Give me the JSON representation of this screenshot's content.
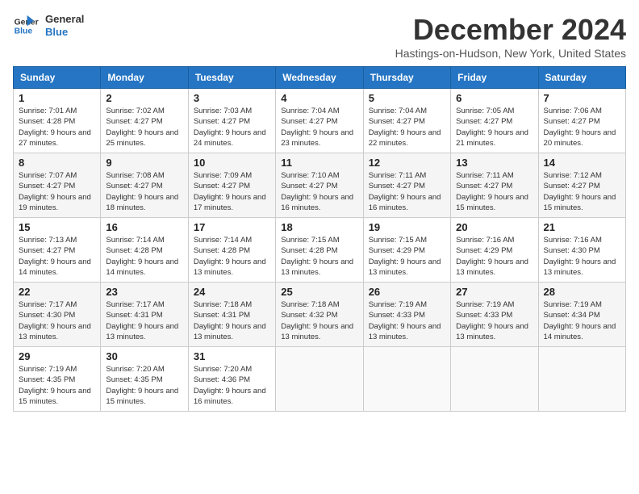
{
  "logo": {
    "line1": "General",
    "line2": "Blue"
  },
  "title": "December 2024",
  "location": "Hastings-on-Hudson, New York, United States",
  "headers": [
    "Sunday",
    "Monday",
    "Tuesday",
    "Wednesday",
    "Thursday",
    "Friday",
    "Saturday"
  ],
  "weeks": [
    [
      {
        "day": "1",
        "sunrise": "Sunrise: 7:01 AM",
        "sunset": "Sunset: 4:28 PM",
        "daylight": "Daylight: 9 hours and 27 minutes."
      },
      {
        "day": "2",
        "sunrise": "Sunrise: 7:02 AM",
        "sunset": "Sunset: 4:27 PM",
        "daylight": "Daylight: 9 hours and 25 minutes."
      },
      {
        "day": "3",
        "sunrise": "Sunrise: 7:03 AM",
        "sunset": "Sunset: 4:27 PM",
        "daylight": "Daylight: 9 hours and 24 minutes."
      },
      {
        "day": "4",
        "sunrise": "Sunrise: 7:04 AM",
        "sunset": "Sunset: 4:27 PM",
        "daylight": "Daylight: 9 hours and 23 minutes."
      },
      {
        "day": "5",
        "sunrise": "Sunrise: 7:04 AM",
        "sunset": "Sunset: 4:27 PM",
        "daylight": "Daylight: 9 hours and 22 minutes."
      },
      {
        "day": "6",
        "sunrise": "Sunrise: 7:05 AM",
        "sunset": "Sunset: 4:27 PM",
        "daylight": "Daylight: 9 hours and 21 minutes."
      },
      {
        "day": "7",
        "sunrise": "Sunrise: 7:06 AM",
        "sunset": "Sunset: 4:27 PM",
        "daylight": "Daylight: 9 hours and 20 minutes."
      }
    ],
    [
      {
        "day": "8",
        "sunrise": "Sunrise: 7:07 AM",
        "sunset": "Sunset: 4:27 PM",
        "daylight": "Daylight: 9 hours and 19 minutes."
      },
      {
        "day": "9",
        "sunrise": "Sunrise: 7:08 AM",
        "sunset": "Sunset: 4:27 PM",
        "daylight": "Daylight: 9 hours and 18 minutes."
      },
      {
        "day": "10",
        "sunrise": "Sunrise: 7:09 AM",
        "sunset": "Sunset: 4:27 PM",
        "daylight": "Daylight: 9 hours and 17 minutes."
      },
      {
        "day": "11",
        "sunrise": "Sunrise: 7:10 AM",
        "sunset": "Sunset: 4:27 PM",
        "daylight": "Daylight: 9 hours and 16 minutes."
      },
      {
        "day": "12",
        "sunrise": "Sunrise: 7:11 AM",
        "sunset": "Sunset: 4:27 PM",
        "daylight": "Daylight: 9 hours and 16 minutes."
      },
      {
        "day": "13",
        "sunrise": "Sunrise: 7:11 AM",
        "sunset": "Sunset: 4:27 PM",
        "daylight": "Daylight: 9 hours and 15 minutes."
      },
      {
        "day": "14",
        "sunrise": "Sunrise: 7:12 AM",
        "sunset": "Sunset: 4:27 PM",
        "daylight": "Daylight: 9 hours and 15 minutes."
      }
    ],
    [
      {
        "day": "15",
        "sunrise": "Sunrise: 7:13 AM",
        "sunset": "Sunset: 4:27 PM",
        "daylight": "Daylight: 9 hours and 14 minutes."
      },
      {
        "day": "16",
        "sunrise": "Sunrise: 7:14 AM",
        "sunset": "Sunset: 4:28 PM",
        "daylight": "Daylight: 9 hours and 14 minutes."
      },
      {
        "day": "17",
        "sunrise": "Sunrise: 7:14 AM",
        "sunset": "Sunset: 4:28 PM",
        "daylight": "Daylight: 9 hours and 13 minutes."
      },
      {
        "day": "18",
        "sunrise": "Sunrise: 7:15 AM",
        "sunset": "Sunset: 4:28 PM",
        "daylight": "Daylight: 9 hours and 13 minutes."
      },
      {
        "day": "19",
        "sunrise": "Sunrise: 7:15 AM",
        "sunset": "Sunset: 4:29 PM",
        "daylight": "Daylight: 9 hours and 13 minutes."
      },
      {
        "day": "20",
        "sunrise": "Sunrise: 7:16 AM",
        "sunset": "Sunset: 4:29 PM",
        "daylight": "Daylight: 9 hours and 13 minutes."
      },
      {
        "day": "21",
        "sunrise": "Sunrise: 7:16 AM",
        "sunset": "Sunset: 4:30 PM",
        "daylight": "Daylight: 9 hours and 13 minutes."
      }
    ],
    [
      {
        "day": "22",
        "sunrise": "Sunrise: 7:17 AM",
        "sunset": "Sunset: 4:30 PM",
        "daylight": "Daylight: 9 hours and 13 minutes."
      },
      {
        "day": "23",
        "sunrise": "Sunrise: 7:17 AM",
        "sunset": "Sunset: 4:31 PM",
        "daylight": "Daylight: 9 hours and 13 minutes."
      },
      {
        "day": "24",
        "sunrise": "Sunrise: 7:18 AM",
        "sunset": "Sunset: 4:31 PM",
        "daylight": "Daylight: 9 hours and 13 minutes."
      },
      {
        "day": "25",
        "sunrise": "Sunrise: 7:18 AM",
        "sunset": "Sunset: 4:32 PM",
        "daylight": "Daylight: 9 hours and 13 minutes."
      },
      {
        "day": "26",
        "sunrise": "Sunrise: 7:19 AM",
        "sunset": "Sunset: 4:33 PM",
        "daylight": "Daylight: 9 hours and 13 minutes."
      },
      {
        "day": "27",
        "sunrise": "Sunrise: 7:19 AM",
        "sunset": "Sunset: 4:33 PM",
        "daylight": "Daylight: 9 hours and 13 minutes."
      },
      {
        "day": "28",
        "sunrise": "Sunrise: 7:19 AM",
        "sunset": "Sunset: 4:34 PM",
        "daylight": "Daylight: 9 hours and 14 minutes."
      }
    ],
    [
      {
        "day": "29",
        "sunrise": "Sunrise: 7:19 AM",
        "sunset": "Sunset: 4:35 PM",
        "daylight": "Daylight: 9 hours and 15 minutes."
      },
      {
        "day": "30",
        "sunrise": "Sunrise: 7:20 AM",
        "sunset": "Sunset: 4:35 PM",
        "daylight": "Daylight: 9 hours and 15 minutes."
      },
      {
        "day": "31",
        "sunrise": "Sunrise: 7:20 AM",
        "sunset": "Sunset: 4:36 PM",
        "daylight": "Daylight: 9 hours and 16 minutes."
      },
      null,
      null,
      null,
      null
    ]
  ]
}
